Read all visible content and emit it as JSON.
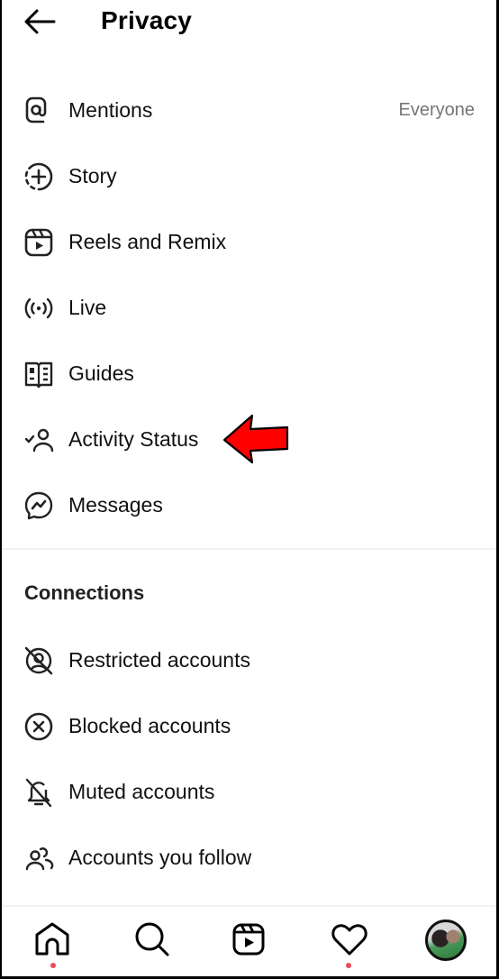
{
  "header": {
    "title": "Privacy",
    "back_icon": "arrow-left-icon"
  },
  "items": [
    {
      "label": "Mentions",
      "value": "Everyone",
      "icon": "at-sign-icon"
    },
    {
      "label": "Story",
      "icon": "story-add-icon"
    },
    {
      "label": "Reels and Remix",
      "icon": "reels-icon"
    },
    {
      "label": "Live",
      "icon": "live-broadcast-icon"
    },
    {
      "label": "Guides",
      "icon": "guides-book-icon"
    },
    {
      "label": "Activity Status",
      "icon": "activity-status-icon"
    },
    {
      "label": "Messages",
      "icon": "messenger-icon"
    }
  ],
  "connections": {
    "title": "Connections",
    "items": [
      {
        "label": "Restricted accounts",
        "icon": "restricted-icon"
      },
      {
        "label": "Blocked accounts",
        "icon": "blocked-icon"
      },
      {
        "label": "Muted accounts",
        "icon": "muted-bell-icon"
      },
      {
        "label": "Accounts you follow",
        "icon": "people-icon"
      }
    ]
  },
  "annotation": {
    "arrow_color": "#ff0000",
    "points_to": "Activity Status"
  },
  "tabbar": {
    "tabs": [
      {
        "name": "home",
        "icon": "home-icon",
        "notification_dot": true
      },
      {
        "name": "search",
        "icon": "search-icon",
        "notification_dot": false
      },
      {
        "name": "reels",
        "icon": "reels-icon",
        "notification_dot": false
      },
      {
        "name": "activity",
        "icon": "heart-icon",
        "notification_dot": true
      },
      {
        "name": "profile",
        "icon": "avatar",
        "notification_dot": false
      }
    ],
    "dot_color": "#ed4956"
  }
}
